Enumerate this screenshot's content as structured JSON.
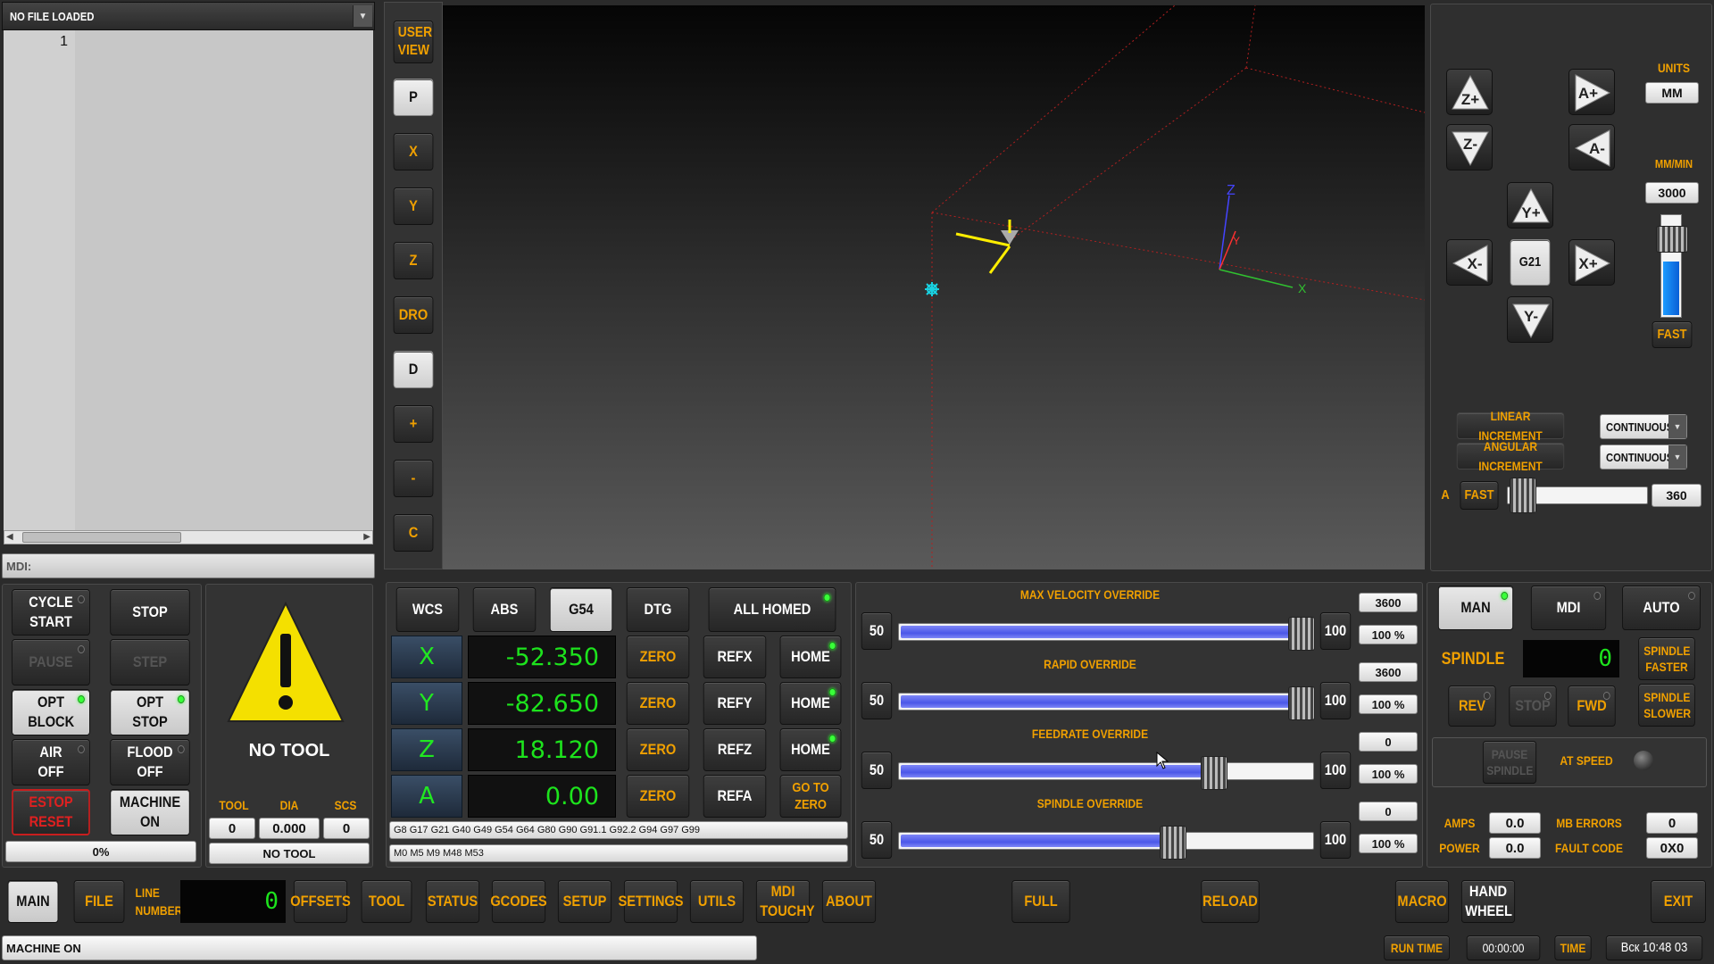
{
  "file_panel": {
    "title": "NO FILE LOADED",
    "line_no": "1",
    "mdi_label": "MDI:"
  },
  "toolbar_left": [
    "USER VIEW",
    "P",
    "X",
    "Y",
    "Z",
    "DRO",
    "D",
    "+",
    "-",
    "C"
  ],
  "viewport": {
    "axis_z": "Z",
    "axis_y": "Y",
    "axis_x": "X"
  },
  "jog": {
    "z_plus": "Z+",
    "z_minus": "Z-",
    "a_plus": "A+",
    "a_minus": "A-",
    "y_plus": "Y+",
    "y_minus": "Y-",
    "x_plus": "X+",
    "x_minus": "X-",
    "center": "G21"
  },
  "units": {
    "label": "UNITS",
    "value": "MM",
    "rate_label": "MM/MIN",
    "rate": "3000",
    "fast": "FAST",
    "jog_rate_level": 0.55
  },
  "increments": {
    "linear_label": "LINEAR INCREMENT",
    "linear_value": "CONTINUOUS",
    "angular_label": "ANGULAR INCREMENT",
    "angular_value": "CONTINUOUS",
    "a_label": "A",
    "fast": "FAST",
    "a_value": "360",
    "a_level": 0.05
  },
  "controls": {
    "cycle_start": "CYCLE START",
    "stop": "STOP",
    "pause": "PAUSE",
    "step": "STEP",
    "opt_block": "OPT BLOCK",
    "opt_stop": "OPT STOP",
    "air": "AIR OFF",
    "flood": "FLOOD OFF",
    "estop": "ESTOP RESET",
    "machine": "MACHINE ON",
    "progress": "0%"
  },
  "tool": {
    "status": "NO TOOL",
    "tool_label": "TOOL",
    "dia_label": "DIA",
    "scs_label": "SCS",
    "tool": "0",
    "dia": "0.000",
    "scs": "0",
    "name": "NO TOOL"
  },
  "dro": {
    "wcs": "WCS",
    "abs": "ABS",
    "g54": "G54",
    "dtg": "DTG",
    "homed": "ALL HOMED",
    "axes": [
      {
        "name": "X",
        "value": "-52.350",
        "zero": "ZERO",
        "ref": "REFX",
        "home": "HOME"
      },
      {
        "name": "Y",
        "value": "-82.650",
        "zero": "ZERO",
        "ref": "REFY",
        "home": "HOME"
      },
      {
        "name": "Z",
        "value": "18.120",
        "zero": "ZERO",
        "ref": "REFZ",
        "home": "HOME"
      },
      {
        "name": "A",
        "value": "0.00",
        "zero": "ZERO",
        "ref": "REFA",
        "home": "GO TO ZERO"
      }
    ],
    "gcodes": "G8 G17 G21 G40 G49 G54 G64 G80 G90 G91.1 G92.2 G94 G97 G99",
    "mcodes": "M0 M5 M9 M48 M53"
  },
  "overrides": [
    {
      "title": "MAX VELOCITY OVERRIDE",
      "min": "50",
      "max": "100",
      "value": "3600",
      "percent": "100 %",
      "level": 1.0
    },
    {
      "title": "RAPID OVERRIDE",
      "min": "50",
      "max": "100",
      "value": "3600",
      "percent": "100 %",
      "level": 1.0
    },
    {
      "title": "FEEDRATE OVERRIDE",
      "min": "50",
      "max": "100",
      "value": "0",
      "percent": "100 %",
      "level": 0.78
    },
    {
      "title": "SPINDLE OVERRIDE",
      "min": "50",
      "max": "100",
      "value": "0",
      "percent": "100 %",
      "level": 0.68
    }
  ],
  "mode": {
    "man": "MAN",
    "mdi": "MDI",
    "auto": "AUTO",
    "spindle": "SPINDLE",
    "spindle_speed": "0",
    "faster": "SPINDLE FASTER",
    "slower": "SPINDLE SLOWER",
    "rev": "REV",
    "stop": "STOP",
    "fwd": "FWD",
    "pause_spindle": "PAUSE SPINDLE",
    "at_speed": "AT SPEED",
    "amps_label": "AMPS",
    "amps": "0.0",
    "mb_errors_label": "MB ERRORS",
    "mb_errors": "0",
    "power_label": "POWER",
    "power": "0.0",
    "fault_label": "FAULT CODE",
    "fault": "0X0"
  },
  "nav": {
    "main": "MAIN",
    "file": "FILE",
    "line_number": "LINE NUMBER",
    "line_value": "0",
    "offsets": "OFFSETS",
    "tool": "TOOL",
    "status": "STATUS",
    "gcodes": "GCODES",
    "setup": "SETUP",
    "settings": "SETTINGS",
    "utils": "UTILS",
    "mdi_touchy": "MDI TOUCHY",
    "about": "ABOUT",
    "full": "FULL",
    "reload": "RELOAD",
    "macro": "MACRO",
    "hand_wheel": "HAND WHEEL",
    "exit": "EXIT"
  },
  "statusbar": {
    "message": "MACHINE ON",
    "run_time_label": "RUN TIME",
    "run_time": "00:00:00",
    "time_label": "TIME",
    "time": "Вск 10:48 03"
  }
}
